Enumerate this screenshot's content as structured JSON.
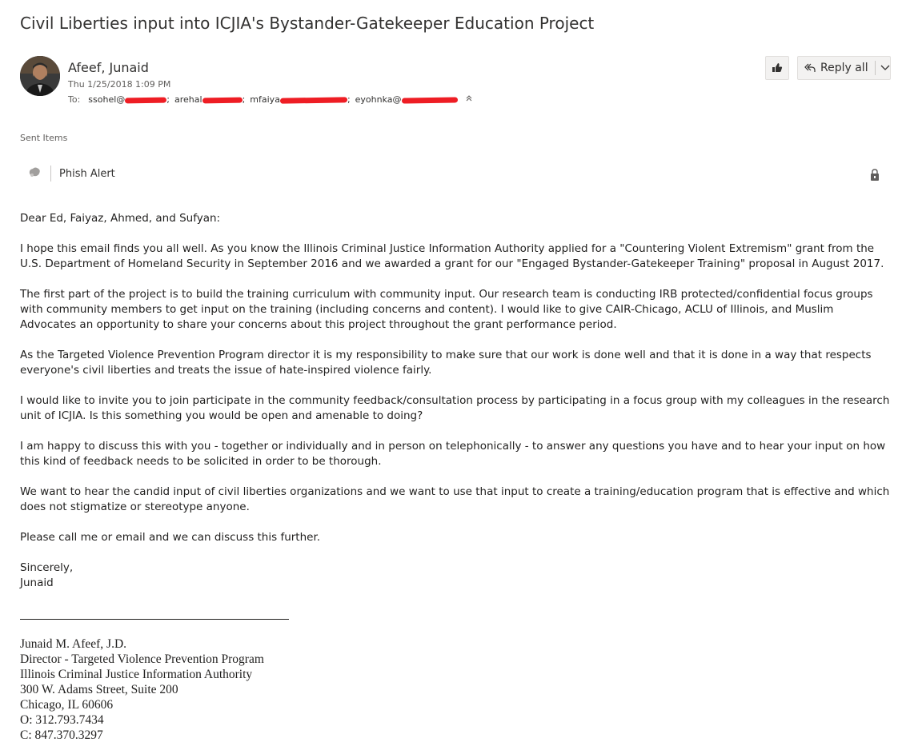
{
  "subject": "Civil Liberties input into ICJIA's Bystander-Gatekeeper Education Project",
  "sender": {
    "name": "Afeef, Junaid",
    "date": "Thu 1/25/2018 1:09 PM"
  },
  "to": {
    "label": "To:",
    "recipients": [
      "ssohel@",
      "arehal",
      "mfaiya",
      "eyohnka@"
    ]
  },
  "actions": {
    "like_icon": "thumbs-up-icon",
    "reply_all_label": "Reply all"
  },
  "folder": "Sent Items",
  "phish_alert": {
    "label": "Phish Alert"
  },
  "body": {
    "greeting": "Dear Ed, Faiyaz, Ahmed, and Sufyan:",
    "paragraphs": [
      "I hope this email finds you all well. As you know the Illinois Criminal Justice Information Authority applied for a \"Countering Violent Extremism\" grant from the U.S. Department of Homeland Security in September 2016 and we awarded a grant for our \"Engaged Bystander-Gatekeeper Training\" proposal in August 2017.",
      "The first part of the project is to build the training curriculum with community input. Our research team is conducting IRB protected/confidential focus groups with community members to get input on the training (including concerns and content). I would like to give CAIR-Chicago, ACLU of Illinois, and Muslim Advocates an opportunity to share your concerns about this project throughout the grant performance period.",
      "As the Targeted Violence Prevention Program director it is my responsibility to make sure that our work is done well and that it is done in a way that respects everyone's civil liberties and treats the issue of hate-inspired violence fairly.",
      "I would like to invite you to join participate in the community feedback/consultation process by participating in a focus group with my colleagues in the research unit of ICJIA.  Is this something you would be open and amenable to doing?",
      "I am happy to discuss this with you - together or individually and in person on telephonically - to answer any questions you have and to hear your input on how this kind of feedback needs to be solicited in order to be thorough.",
      "We want to hear the candid input of civil liberties organizations and we want to use that input to create a training/education program that is effective and which does not stigmatize or stereotype anyone.",
      "Please call me or email and we can discuss this further."
    ],
    "closing": "Sincerely,",
    "sign_name": "Junaid"
  },
  "signature": {
    "lines": [
      "Junaid M. Afeef, J.D.",
      "Director - Targeted Violence Prevention Program",
      "Illinois Criminal Justice Information Authority",
      "300 W. Adams Street, Suite 200",
      "Chicago, IL 60606",
      "O: 312.793.7434",
      "C: 847.370.3297"
    ]
  },
  "colors": {
    "redaction": "#ee1d24",
    "button_bg": "#f3f2f1",
    "muted_text": "#605e5c"
  }
}
